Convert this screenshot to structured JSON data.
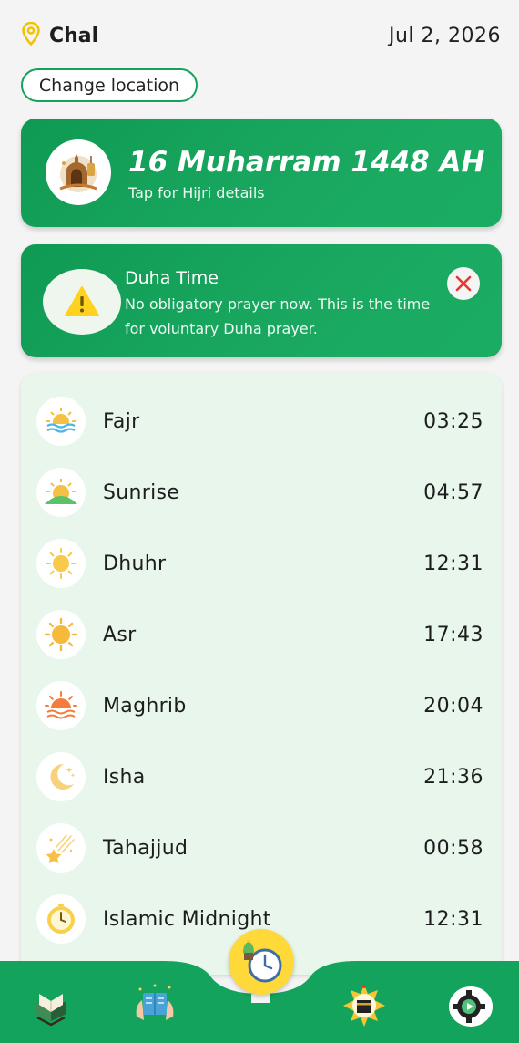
{
  "header": {
    "location": "Chal",
    "date": "Jul 2, 2026",
    "change_location": "Change location"
  },
  "hijri": {
    "title": "16 Muharram 1448 AH",
    "subtitle": "Tap for Hijri details"
  },
  "alert": {
    "title": "Duha Time",
    "body": "No obligatory prayer now. This is the time for voluntary Duha prayer."
  },
  "prayers": [
    {
      "name": "Fajr",
      "time": "03:25",
      "icon": "sunrise-water-icon"
    },
    {
      "name": "Sunrise",
      "time": "04:57",
      "icon": "sunrise-hill-icon"
    },
    {
      "name": "Dhuhr",
      "time": "12:31",
      "icon": "sun-icon"
    },
    {
      "name": "Asr",
      "time": "17:43",
      "icon": "sun-bright-icon"
    },
    {
      "name": "Maghrib",
      "time": "20:04",
      "icon": "sunset-icon"
    },
    {
      "name": "Isha",
      "time": "21:36",
      "icon": "crescent-moon-icon"
    },
    {
      "name": "Tahajjud",
      "time": "00:58",
      "icon": "shooting-stars-icon"
    },
    {
      "name": "Islamic Midnight",
      "time": "12:31",
      "icon": "clock-icon"
    }
  ],
  "nav": {
    "items": [
      "quran-icon",
      "dua-reading-icon",
      "prayer-clock-icon",
      "kaaba-compass-icon",
      "settings-icon"
    ]
  },
  "colors": {
    "green": "#14a35c",
    "card_bg": "#e8f6eb",
    "accent_yellow": "#ffd83a",
    "close_red": "#e53935"
  }
}
